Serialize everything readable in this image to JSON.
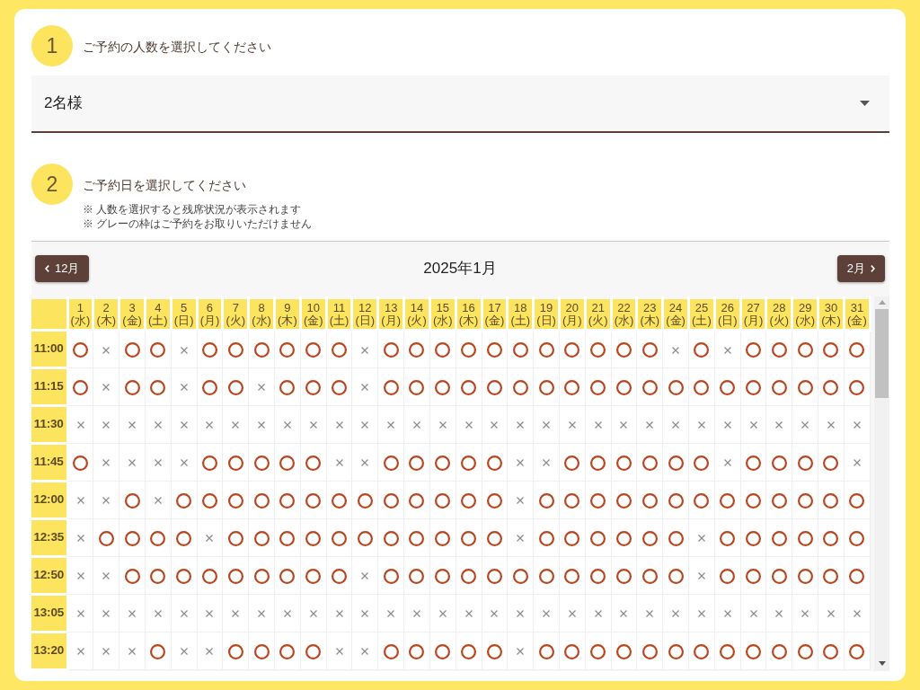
{
  "party_step": {
    "number": "1",
    "title": "ご予約の人数を選択してください",
    "select": {
      "value": "2名様"
    }
  },
  "date_step": {
    "number": "2",
    "title": "ご予約日を選択してください",
    "notes": [
      "※ 人数を選択すると残席状況が表示されます",
      "※ グレーの枠はご予約をお取りいただけません"
    ]
  },
  "calendar": {
    "prev_button": "12月",
    "month": "2025年1月",
    "next_button": "2月",
    "days": [
      {
        "date": "1",
        "weekday": "(水)"
      },
      {
        "date": "2",
        "weekday": "(木)"
      },
      {
        "date": "3",
        "weekday": "(金)"
      },
      {
        "date": "4",
        "weekday": "(土)"
      },
      {
        "date": "5",
        "weekday": "(日)"
      },
      {
        "date": "6",
        "weekday": "(月)"
      },
      {
        "date": "7",
        "weekday": "(火)"
      },
      {
        "date": "8",
        "weekday": "(水)"
      },
      {
        "date": "9",
        "weekday": "(木)"
      },
      {
        "date": "10",
        "weekday": "(金)"
      },
      {
        "date": "11",
        "weekday": "(土)"
      },
      {
        "date": "12",
        "weekday": "(日)"
      },
      {
        "date": "13",
        "weekday": "(月)"
      },
      {
        "date": "14",
        "weekday": "(火)"
      },
      {
        "date": "15",
        "weekday": "(水)"
      },
      {
        "date": "16",
        "weekday": "(木)"
      },
      {
        "date": "17",
        "weekday": "(金)"
      },
      {
        "date": "18",
        "weekday": "(土)"
      },
      {
        "date": "19",
        "weekday": "(日)"
      },
      {
        "date": "20",
        "weekday": "(月)"
      },
      {
        "date": "21",
        "weekday": "(火)"
      },
      {
        "date": "22",
        "weekday": "(水)"
      },
      {
        "date": "23",
        "weekday": "(木)"
      },
      {
        "date": "24",
        "weekday": "(金)"
      },
      {
        "date": "25",
        "weekday": "(土)"
      },
      {
        "date": "26",
        "weekday": "(日)"
      },
      {
        "date": "27",
        "weekday": "(月)"
      },
      {
        "date": "28",
        "weekday": "(火)"
      },
      {
        "date": "29",
        "weekday": "(水)"
      },
      {
        "date": "30",
        "weekday": "(木)"
      },
      {
        "date": "31",
        "weekday": "(金)"
      }
    ],
    "rows": [
      {
        "time": "11:00",
        "available": [
          true,
          false,
          true,
          true,
          false,
          true,
          true,
          true,
          true,
          true,
          true,
          false,
          true,
          true,
          true,
          true,
          true,
          true,
          true,
          true,
          true,
          true,
          true,
          false,
          true,
          false,
          true,
          true,
          true,
          true,
          true
        ]
      },
      {
        "time": "11:15",
        "available": [
          true,
          false,
          true,
          true,
          false,
          true,
          true,
          false,
          true,
          true,
          true,
          false,
          true,
          true,
          true,
          true,
          true,
          true,
          true,
          true,
          true,
          true,
          true,
          true,
          true,
          true,
          true,
          true,
          true,
          true,
          true
        ]
      },
      {
        "time": "11:30",
        "available": [
          false,
          false,
          false,
          false,
          false,
          false,
          false,
          false,
          false,
          false,
          false,
          false,
          false,
          false,
          false,
          false,
          false,
          false,
          false,
          false,
          false,
          false,
          false,
          false,
          false,
          false,
          false,
          false,
          false,
          false,
          false
        ]
      },
      {
        "time": "11:45",
        "available": [
          true,
          false,
          false,
          false,
          false,
          true,
          true,
          true,
          true,
          true,
          false,
          false,
          true,
          true,
          true,
          true,
          true,
          false,
          false,
          true,
          true,
          true,
          true,
          true,
          true,
          false,
          true,
          true,
          true,
          true,
          false
        ]
      },
      {
        "time": "12:00",
        "available": [
          false,
          false,
          true,
          false,
          true,
          true,
          true,
          true,
          true,
          true,
          true,
          true,
          true,
          true,
          true,
          true,
          true,
          false,
          true,
          true,
          true,
          true,
          true,
          true,
          true,
          true,
          true,
          true,
          true,
          true,
          true
        ]
      },
      {
        "time": "12:35",
        "available": [
          false,
          true,
          true,
          true,
          true,
          false,
          true,
          true,
          true,
          true,
          true,
          true,
          true,
          true,
          true,
          true,
          true,
          false,
          true,
          true,
          true,
          true,
          true,
          true,
          false,
          true,
          true,
          true,
          true,
          true,
          true
        ]
      },
      {
        "time": "12:50",
        "available": [
          false,
          false,
          true,
          true,
          true,
          true,
          true,
          true,
          true,
          true,
          true,
          false,
          true,
          true,
          true,
          true,
          true,
          true,
          true,
          true,
          true,
          true,
          true,
          true,
          false,
          true,
          true,
          true,
          true,
          true,
          true
        ]
      },
      {
        "time": "13:05",
        "available": [
          false,
          false,
          false,
          false,
          false,
          false,
          false,
          false,
          false,
          false,
          false,
          false,
          false,
          false,
          false,
          false,
          false,
          false,
          false,
          false,
          false,
          false,
          false,
          false,
          false,
          false,
          false,
          false,
          false,
          false,
          false
        ]
      },
      {
        "time": "13:20",
        "available": [
          false,
          false,
          false,
          true,
          false,
          false,
          true,
          true,
          true,
          true,
          false,
          false,
          true,
          true,
          true,
          true,
          true,
          false,
          true,
          true,
          true,
          true,
          true,
          true,
          true,
          true,
          true,
          true,
          true,
          true,
          true
        ]
      }
    ]
  }
}
